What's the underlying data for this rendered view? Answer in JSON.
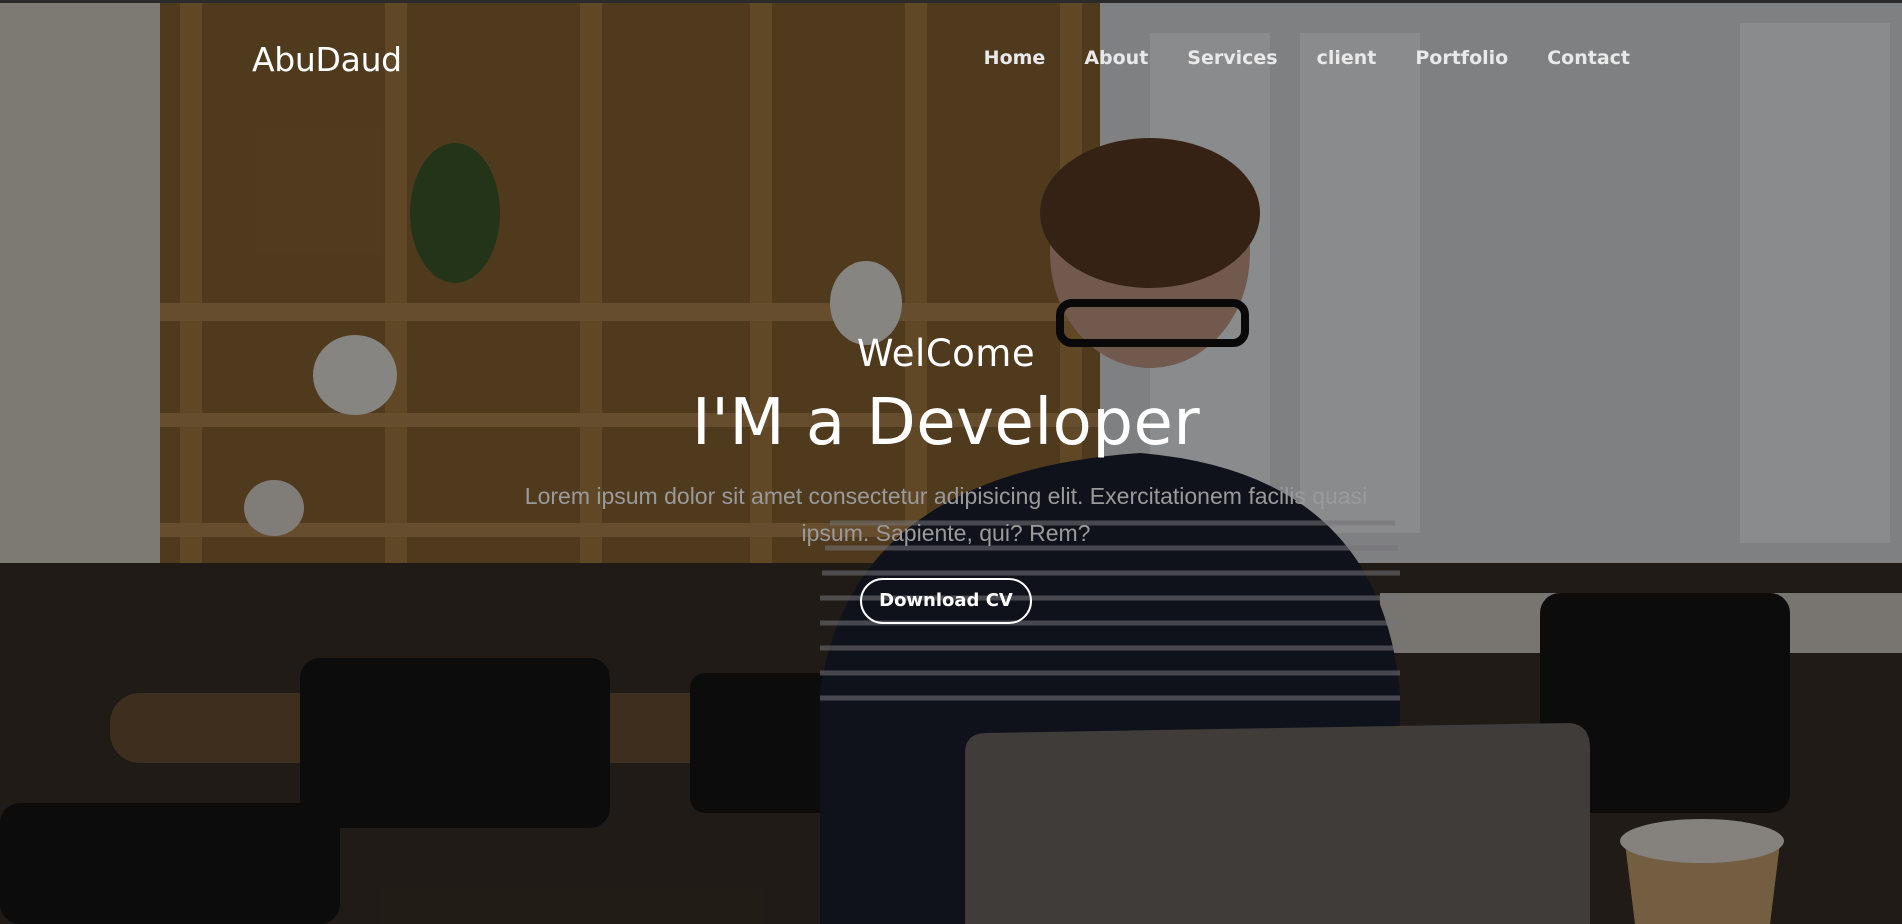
{
  "navbar": {
    "brand": "AbuDaud",
    "links": [
      {
        "label": "Home"
      },
      {
        "label": "About"
      },
      {
        "label": "Services"
      },
      {
        "label": "client"
      },
      {
        "label": "Portfolio"
      },
      {
        "label": "Contact"
      }
    ]
  },
  "hero": {
    "welcome": "WelCome",
    "headline": "I'M a Developer",
    "description": "Lorem ipsum dolor sit amet consectetur adipisicing elit. Exercitationem facilis quasi ipsum. Sapiente, qui? Rem?",
    "cta_label": "Download CV"
  },
  "colors": {
    "text": "#ffffff",
    "nav_text": "#e9e9e9",
    "description_text": "#9a9a9a",
    "overlay": "rgba(0,0,0,0.42)"
  }
}
